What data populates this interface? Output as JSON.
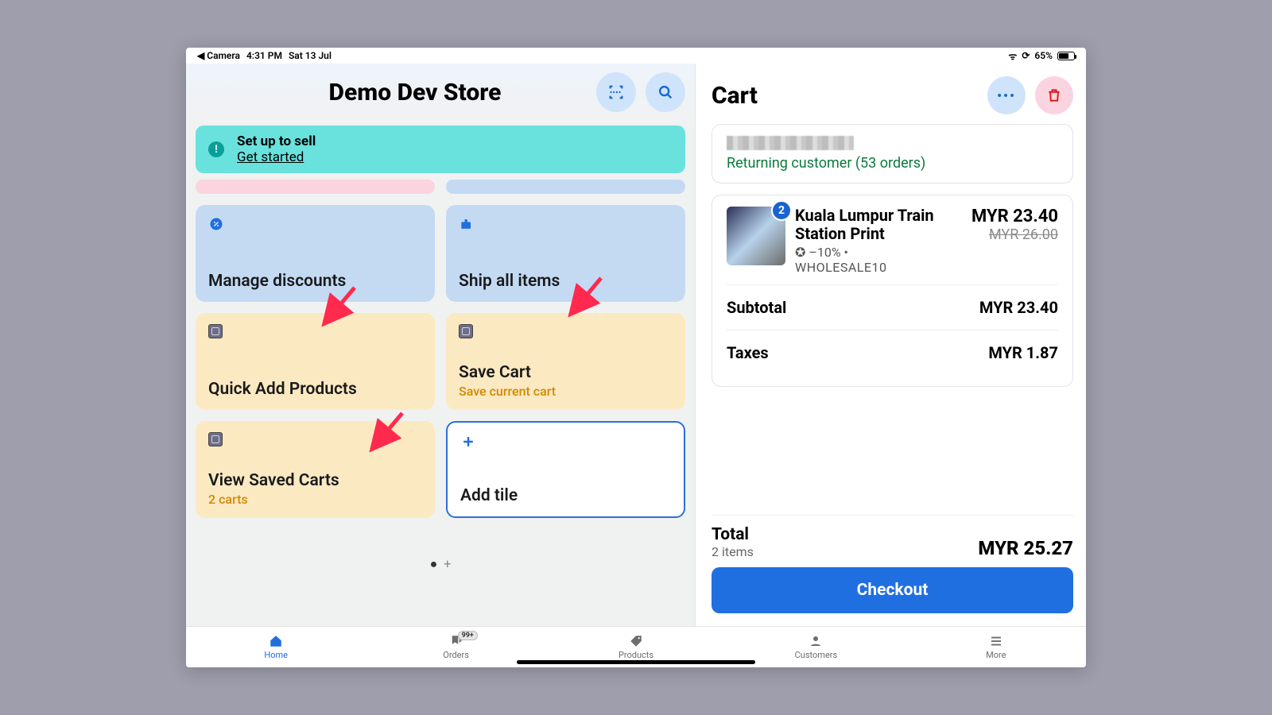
{
  "status": {
    "back_app": "Camera",
    "time": "4:31 PM",
    "date": "Sat 13 Jul",
    "battery_pct": "65%"
  },
  "store": {
    "title": "Demo Dev Store"
  },
  "banner": {
    "title": "Set up to sell",
    "link": "Get started"
  },
  "tiles": {
    "manage_discounts": "Manage discounts",
    "ship_all": "Ship all items",
    "quick_add": "Quick Add Products",
    "save_cart": "Save Cart",
    "save_cart_sub": "Save current cart",
    "view_saved": "View Saved Carts",
    "view_saved_sub": "2 carts",
    "add_tile": "Add tile"
  },
  "cart": {
    "title": "Cart",
    "customer_status": "Returning customer (53 orders)",
    "item": {
      "qty": "2",
      "name": "Kuala Lumpur Train Station Print",
      "discount_line": "–10% •",
      "discount_code": "WHOLESALE10",
      "price": "MYR 23.40",
      "orig": "MYR 26.00"
    },
    "subtotal_label": "Subtotal",
    "subtotal": "MYR 23.40",
    "taxes_label": "Taxes",
    "taxes": "MYR 1.87",
    "total_label": "Total",
    "total_items": "2 items",
    "total": "MYR 25.27",
    "checkout": "Checkout"
  },
  "tabs": {
    "home": "Home",
    "orders": "Orders",
    "orders_badge": "99+",
    "products": "Products",
    "customers": "Customers",
    "more": "More"
  }
}
